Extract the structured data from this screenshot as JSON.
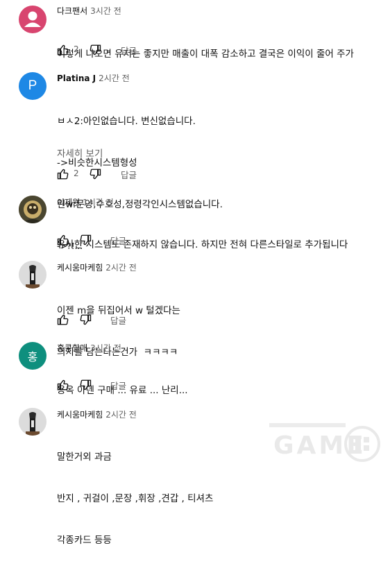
{
  "comments": [
    {
      "author": "다크팬서",
      "time": "3시간 전",
      "lines": [
        "이렇게 나오면 유저는 좋지만 매출이 대폭 감소하고 결국은 이익이 줄어 주가"
      ],
      "likes": "2",
      "reply": "답글",
      "avatar_color": "#d8456f"
    },
    {
      "author": "Platina J",
      "time": "2시간 전",
      "avatar_letter": "P",
      "lines": [
        "ㅂㅅ2:아인없습니다. 변신없습니다.",
        "->비슷한시스템형성",
        "린w:문양,수호성,정령각인시스템없습니다.",
        "->?!..."
      ],
      "more": "자세히 보기",
      "likes": "2",
      "reply": "답글",
      "avatar_color": "#1e88e5"
    },
    {
      "author": "이제원",
      "time": "1시간 전",
      "lines": [
        "유사한 시스템도 존재하지 않습니다. 하지만 전혀 다른스타일로 추가됩니다"
      ],
      "reply": "답글"
    },
    {
      "author": "케시움마케힘",
      "time": "2시간 전",
      "lines": [
        "이젠 m을 뒤집어서 w 털겠다는",
        "의지를 담는다는건가  ㅋㅋㅋㅋ"
      ],
      "reply": "답글"
    },
    {
      "author": "홍콩할매",
      "time": "3시간 전",
      "avatar_letter": "홍",
      "lines": [
        "용옥 아덴 구매 ... 유료 ... 난리..."
      ],
      "reply": "답글",
      "avatar_color": "#0e8f7e"
    },
    {
      "author": "케시움마케힘",
      "time": "2시간 전",
      "lines": [
        "말한거외 과금",
        "반지 , 귀걸이 ,문장 ,휘장 ,견갑 , 티셔츠",
        "각종카드 등등"
      ]
    }
  ],
  "watermark_text": "GAME"
}
